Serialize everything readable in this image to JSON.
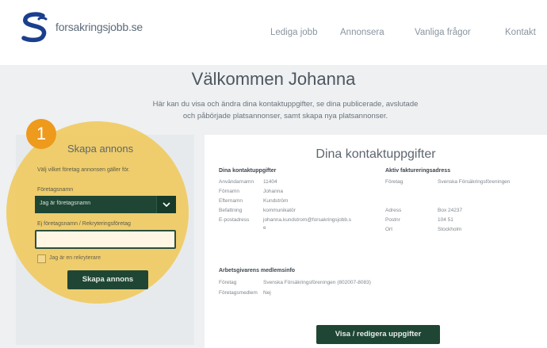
{
  "brand": {
    "name": "forsakringsjobb.se",
    "color": "#1b3f8e"
  },
  "nav": [
    {
      "label": "Lediga jobb"
    },
    {
      "label": "Annonsera"
    },
    {
      "label": "Vanliga frågor"
    },
    {
      "label": "Kontakt"
    }
  ],
  "welcome": {
    "title": "Välkommen Johanna",
    "text_line1": "Här kan du visa och ändra dina kontaktuppgifter, se dina publicerade, avslutade",
    "text_line2": "och påbörjade platsannonser, samt skapa nya platsannonser."
  },
  "step_badge": "1",
  "skapa": {
    "title": "Skapa annons",
    "hint": "Välj vilket företag annonsen gäller för.",
    "company_label": "Företagsnamn",
    "company_value": "Jag är företagsnamn",
    "orgnr_label": "Ej företagsnamn / Rekryteringsföretag",
    "orgnr_value": "",
    "checkbox_label": "Jag är en rekryterare",
    "button": "Skapa annons"
  },
  "contact": {
    "title": "Dina kontaktuppgifter",
    "left_head": "Dina kontaktuppgifter",
    "left_rows": [
      {
        "label": "Användarnamn",
        "value": "11404"
      },
      {
        "label": "Förnamn",
        "value": "Johanna"
      },
      {
        "label": "Efternamn",
        "value": "Kundström"
      },
      {
        "label": "Befattning",
        "value": "kommunikatör"
      },
      {
        "label": "E-postadress",
        "value": "johanna.kundstrom@forsakringsjobb.se"
      }
    ],
    "right_head": "Aktiv faktureringsadress",
    "right_rows": [
      {
        "label": "Företag",
        "value": "Svenska Försäkringsföreningen"
      },
      {
        "label": "Adress",
        "value": "Box 24237"
      },
      {
        "label": "Postnr",
        "value": "104 51"
      },
      {
        "label": "Ort",
        "value": "Stockholm"
      }
    ],
    "member_head": "Arbetsgivarens medlemsinfo",
    "member_rows": [
      {
        "label": "Företag",
        "value": "Svenska Försäkringsföreningen (802007-8083)"
      },
      {
        "label": "Företagsmedlem",
        "value": "Nej"
      }
    ],
    "button": "Visa / redigera uppgifter"
  }
}
